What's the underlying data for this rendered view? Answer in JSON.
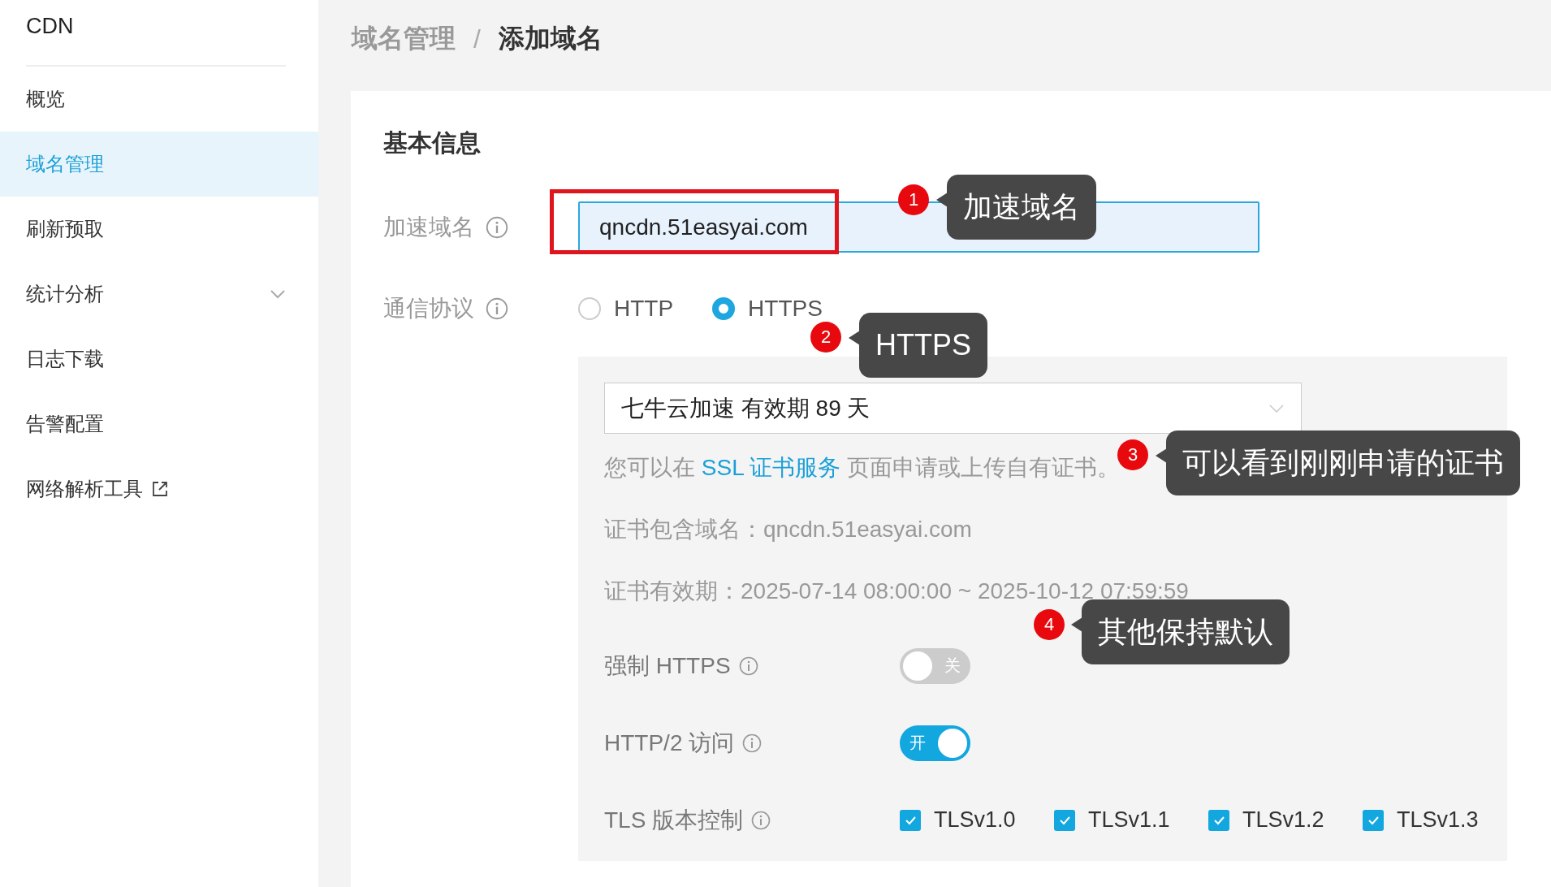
{
  "sidebar": {
    "title": "CDN",
    "items": [
      {
        "label": "概览",
        "selected": false,
        "kind": "plain"
      },
      {
        "label": "域名管理",
        "selected": true,
        "kind": "plain"
      },
      {
        "label": "刷新预取",
        "selected": false,
        "kind": "plain"
      },
      {
        "label": "统计分析",
        "selected": false,
        "kind": "submenu"
      },
      {
        "label": "日志下载",
        "selected": false,
        "kind": "plain"
      },
      {
        "label": "告警配置",
        "selected": false,
        "kind": "plain"
      },
      {
        "label": "网络解析工具",
        "selected": false,
        "kind": "external"
      }
    ]
  },
  "breadcrumb": {
    "items": [
      "域名管理",
      "添加域名"
    ],
    "separator": "/"
  },
  "form": {
    "section_title": "基本信息",
    "domain": {
      "label": "加速域名",
      "value": "qncdn.51easyai.com"
    },
    "protocol": {
      "label": "通信协议",
      "options": [
        {
          "label": "HTTP",
          "selected": false
        },
        {
          "label": "HTTPS",
          "selected": true
        }
      ]
    },
    "certificate": {
      "value": "七牛云加速 有效期 89 天",
      "help_before": "您可以在 ",
      "help_link": "SSL 证书服务",
      "help_after": " 页面申请或上传自有证书。",
      "domains_label": "证书包含域名：",
      "domains": "qncdn.51easyai.com",
      "validity_label": "证书有效期：",
      "validity": "2025-07-14 08:00:00 ~ 2025-10-12 07:59:59"
    },
    "settings": [
      {
        "kind": "switch",
        "label": "强制 HTTPS",
        "on": false,
        "state_text": "关"
      },
      {
        "kind": "switch",
        "label": "HTTP/2 访问",
        "on": true,
        "state_text": "开"
      },
      {
        "kind": "checkboxes",
        "label": "TLS 版本控制",
        "options": [
          {
            "label": "TLSv1.0",
            "checked": true
          },
          {
            "label": "TLSv1.1",
            "checked": true
          },
          {
            "label": "TLSv1.2",
            "checked": true
          },
          {
            "label": "TLSv1.3",
            "checked": true
          }
        ]
      }
    ]
  },
  "annotations": [
    {
      "number": "1",
      "text": "加速域名"
    },
    {
      "number": "2",
      "text": "HTTPS"
    },
    {
      "number": "3",
      "text": "可以看到刚刚申请的证书"
    },
    {
      "number": "4",
      "text": "其他保持默认"
    }
  ]
}
